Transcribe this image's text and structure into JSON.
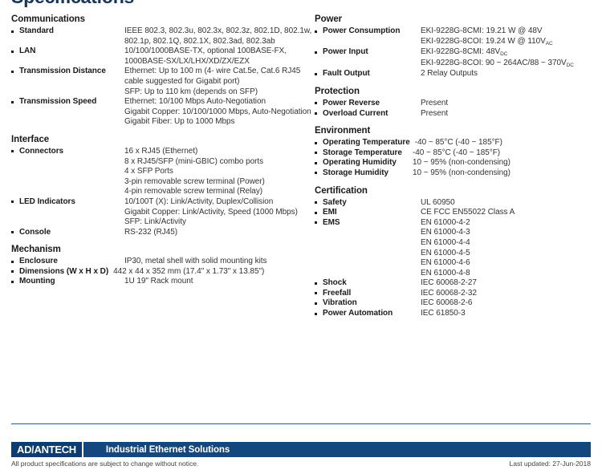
{
  "page_title": "Specifications",
  "left_column": [
    {
      "title": "Communications",
      "label_width": "fixed",
      "rows": [
        {
          "label": "Standard",
          "values": [
            "IEEE 802.3, 802.3u, 802.3x, 802.3z, 802.1D, 802.1w,",
            "802.1p, 802.1Q, 802.1X, 802.3ad, 802.3ab"
          ]
        },
        {
          "label": "LAN",
          "values": [
            "10/100/1000BASE-TX, optional 100BASE-FX,",
            "1000BASE-SX/LX/LHX/XD/ZX/EZX"
          ]
        },
        {
          "label": "Transmission Distance",
          "values": [
            "Ethernet: Up to 100 m (4- wire Cat.5e, Cat.6 RJ45",
            "cable suggested for Gigabit port)",
            "SFP: Up to 110 km (depends on SFP)"
          ]
        },
        {
          "label": "Transmission Speed",
          "values": [
            "Ethernet: 10/100 Mbps Auto-Negotiation",
            "Gigabit Copper: 10/100/1000 Mbps, Auto-Negotiation",
            "Gigabit Fiber: Up to 1000 Mbps"
          ]
        }
      ]
    },
    {
      "title": "Interface",
      "label_width": "fixed",
      "rows": [
        {
          "label": "Connectors",
          "values": [
            "16 x RJ45 (Ethernet)",
            "8 x RJ45/SFP (mini-GBIC) combo ports",
            "4 x SFP Ports",
            "3-pin removable screw terminal (Power)",
            "4-pin removable screw terminal (Relay)"
          ]
        },
        {
          "label": "LED Indicators",
          "values": [
            "10/100T (X): Link/Activity, Duplex/Collision",
            "Gigabit Copper: Link/Activity, Speed (1000 Mbps)",
            "SFP: Link/Activity"
          ]
        },
        {
          "label": "Console",
          "values": [
            "RS-232 (RJ45)"
          ]
        }
      ]
    },
    {
      "title": "Mechanism",
      "label_width": "mixed",
      "rows": [
        {
          "label": "Enclosure",
          "values": [
            "IP30, metal shell with solid mounting kits"
          ],
          "width": "fixed"
        },
        {
          "label": "Dimensions (W x H x D)",
          "values": [
            "442 x 44 x 352 mm (17.4\" x 1.73\" x 13.85\")"
          ],
          "width": "auto"
        },
        {
          "label": "Mounting",
          "values": [
            "1U 19\" Rack mount"
          ],
          "width": "fixed"
        }
      ]
    }
  ],
  "right_column": [
    {
      "title": "Power",
      "label_width": "fixed",
      "rows": [
        {
          "label": "Power Consumption",
          "values": [
            "EKI-9228G-8CMI: 19.21 W @ 48V",
            "EKI-9228G-8COI: 19.24 W @ 110V|AC"
          ]
        },
        {
          "label": "Power Input",
          "values": [
            "EKI-9228G-8CMI: 48V|DC",
            "EKI-9228G-8COI: 90 ~ 264AC/88 ~ 370V|DC"
          ]
        },
        {
          "label": "Fault Output",
          "values": [
            "2 Relay Outputs"
          ]
        }
      ]
    },
    {
      "title": "Protection",
      "label_width": "fixed",
      "rows": [
        {
          "label": "Power Reverse",
          "values": [
            "Present"
          ]
        },
        {
          "label": "Overload Current",
          "values": [
            "Present"
          ]
        }
      ]
    },
    {
      "title": "Environment",
      "label_width": "auto",
      "rows": [
        {
          "label": "Operating Temperature",
          "values": [
            "-40 ~ 85°C (-40 ~ 185°F)"
          ],
          "width": "auto"
        },
        {
          "label": "Storage Temperature",
          "values": [
            "-40 ~ 85°C (-40 ~ 185°F)"
          ],
          "width": "auto-pad"
        },
        {
          "label": "Operating Humidity",
          "values": [
            "10 ~ 95% (non-condensing)"
          ],
          "width": "auto-pad"
        },
        {
          "label": "Storage Humidity",
          "values": [
            "10 ~ 95% (non-condensing)"
          ],
          "width": "auto-pad"
        }
      ]
    },
    {
      "title": "Certification",
      "label_width": "fixed",
      "rows": [
        {
          "label": "Safety",
          "values": [
            "UL 60950"
          ]
        },
        {
          "label": "EMI",
          "values": [
            "CE FCC EN55022 Class A"
          ]
        },
        {
          "label": "EMS",
          "values": [
            "EN 61000-4-2",
            "EN 61000-4-3",
            "EN 61000-4-4",
            "EN 61000-4-5",
            "EN 61000-4-6",
            "EN 61000-4-8"
          ]
        },
        {
          "label": "Shock",
          "values": [
            "IEC 60068-2-27"
          ]
        },
        {
          "label": "Freefall",
          "values": [
            "IEC 60068-2-32"
          ]
        },
        {
          "label": "Vibration",
          "values": [
            "IEC 60068-2-6"
          ]
        },
        {
          "label": "Power Automation",
          "values": [
            "IEC 61850-3"
          ]
        }
      ]
    }
  ],
  "footer": {
    "logo_part1": "AD",
    "logo_slash": "\\",
    "logo_part2": "ANTECH",
    "tagline": "Industrial Ethernet Solutions",
    "disclaimer": "All product specifications are subject to change without notice.",
    "last_updated": "Last updated: 27-Jun-2018"
  },
  "colors": {
    "title_navy": "#13355e",
    "footer_dark": "#0d3c70",
    "footer_blue": "#15477f",
    "rule_blue": "#1f5a9e"
  }
}
